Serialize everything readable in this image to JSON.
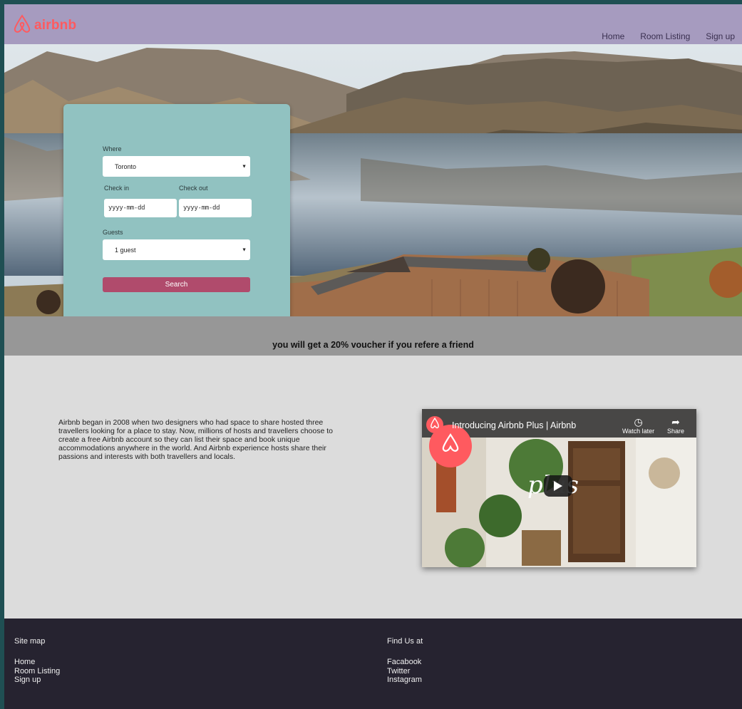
{
  "header": {
    "logo_text": "airbnb",
    "nav": [
      "Home",
      "Room Listing",
      "Sign up"
    ]
  },
  "search": {
    "where_label": "Where",
    "where_value": "Toronto",
    "checkin_label": "Check in",
    "checkout_label": "Check out",
    "checkin_placeholder": "yyyy-mm-dd",
    "checkout_placeholder": "yyyy-mm-dd",
    "guests_label": "Guests",
    "guests_value": "1 guest",
    "button": "Search"
  },
  "voucher": "you will get a 20% voucher if you refere a friend",
  "about": "Airbnb began in 2008 when two designers who had space to share hosted three travellers looking for a place to stay. Now, millions of hosts and travellers choose to create a free Airbnb account so they can list their space and book unique accommodations anywhere in the world. And Airbnb experience hosts share their passions and interests with both travellers and locals.",
  "video": {
    "title": "Introducing Airbnb Plus | Airbnb",
    "watch_later": "Watch later",
    "share": "Share",
    "overlay_text": "plus"
  },
  "footer": {
    "col1_title": "Site map",
    "col1_links": [
      "Home",
      "Room Listing",
      "Sign up"
    ],
    "col2_title": "Find Us at",
    "col2_links": [
      "Facabook",
      "Twitter",
      "Instagram"
    ]
  },
  "colors": {
    "header": "#a69bbf",
    "brand": "#ff5a5f",
    "card": "#91c2c1",
    "button": "#b04b6c",
    "footer": "#262330"
  }
}
